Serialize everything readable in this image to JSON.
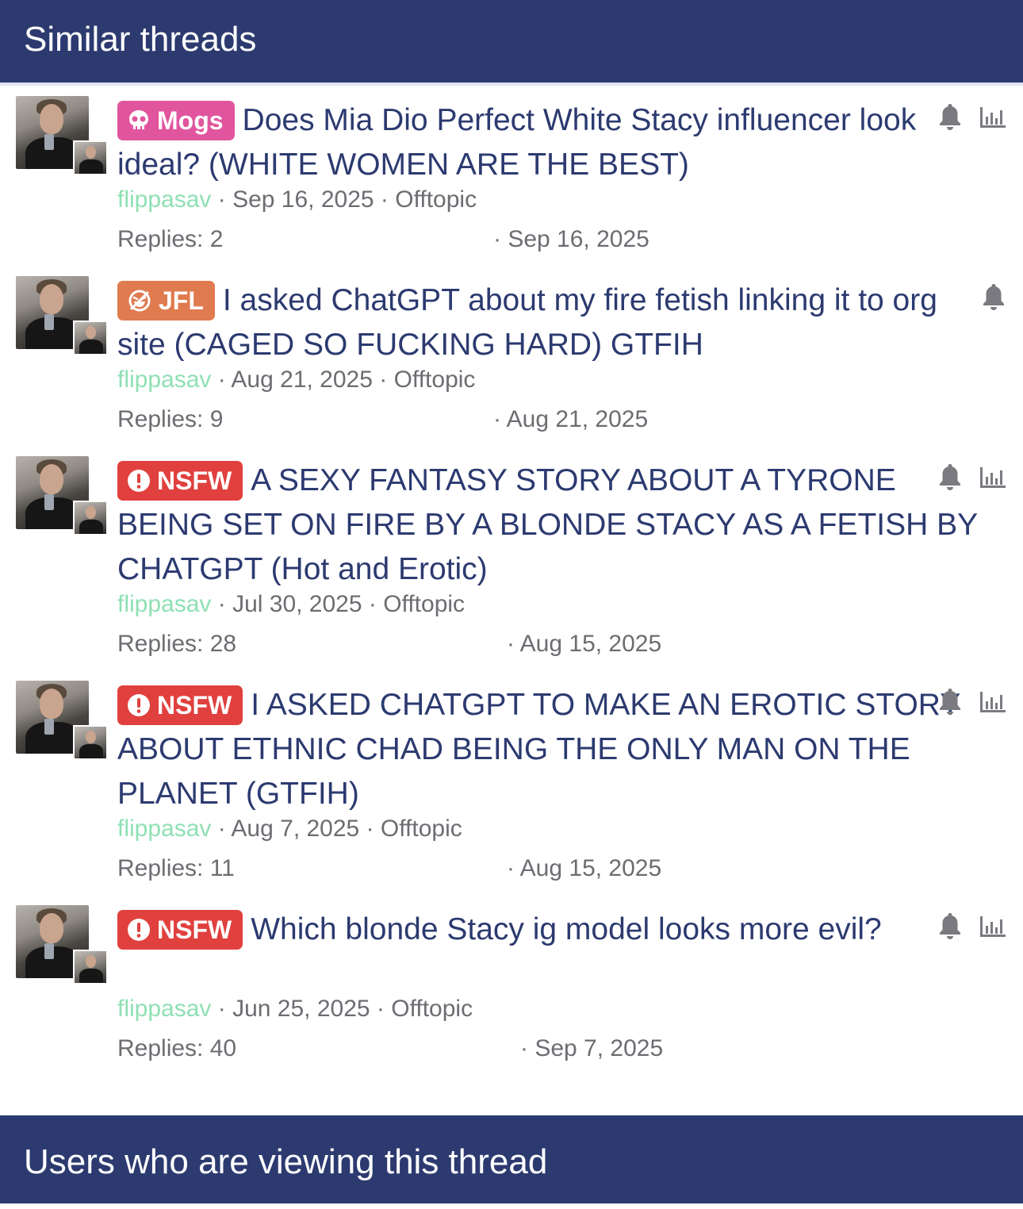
{
  "header": {
    "title": "Similar threads"
  },
  "footer": {
    "title": "Users who are viewing this thread"
  },
  "threads": [
    {
      "badge": "Mogs",
      "badge_icon": "skull-icon",
      "badge_color": "#e0559d",
      "title": "Does Mia Dio Perfect White Stacy influencer look ideal? (WHITE WOMEN ARE THE BEST)",
      "author": "flippasav",
      "date": "Sep 16, 2025",
      "forum": "Offtopic",
      "replies": "Replies: 2",
      "last_post": "· Sep 16, 2025",
      "has_stats_icon": true
    },
    {
      "badge": "JFL",
      "badge_icon": "laugh-icon",
      "badge_color": "#e07a4f",
      "title": "I asked ChatGPT about my fire fetish linking it to org site (CAGED SO FUCKING HARD) GTFIH",
      "author": "flippasav",
      "date": "Aug 21, 2025",
      "forum": "Offtopic",
      "replies": "Replies: 9",
      "last_post": "· Aug 21, 2025",
      "has_stats_icon": false
    },
    {
      "badge": "NSFW",
      "badge_icon": "exclamation-circle-icon",
      "badge_color": "#e0403e",
      "title": "A SEXY FANTASY STORY ABOUT A TYRONE BEING SET ON FIRE BY A BLONDE STACY AS A FETISH BY CHATGPT (Hot and Erotic)",
      "author": "flippasav",
      "date": "Jul 30, 2025",
      "forum": "Offtopic",
      "replies": "Replies: 28",
      "last_post": "· Aug 15, 2025",
      "has_stats_icon": true
    },
    {
      "badge": "NSFW",
      "badge_icon": "exclamation-circle-icon",
      "badge_color": "#e0403e",
      "title": "I ASKED CHATGPT TO MAKE AN EROTIC STORY ABOUT ETHNIC CHAD BEING THE ONLY MAN ON THE PLANET (GTFIH)",
      "author": "flippasav",
      "date": "Aug 7, 2025",
      "forum": "Offtopic",
      "replies": "Replies: 11",
      "last_post": "· Aug 15, 2025",
      "has_stats_icon": true
    },
    {
      "badge": "NSFW",
      "badge_icon": "exclamation-circle-icon",
      "badge_color": "#e0403e",
      "title": "Which blonde Stacy ig model looks more evil?",
      "author": "flippasav",
      "date": "Jun 25, 2025",
      "forum": "Offtopic",
      "replies": "Replies: 40",
      "last_post": "· Sep 7, 2025",
      "has_stats_icon": true
    }
  ]
}
